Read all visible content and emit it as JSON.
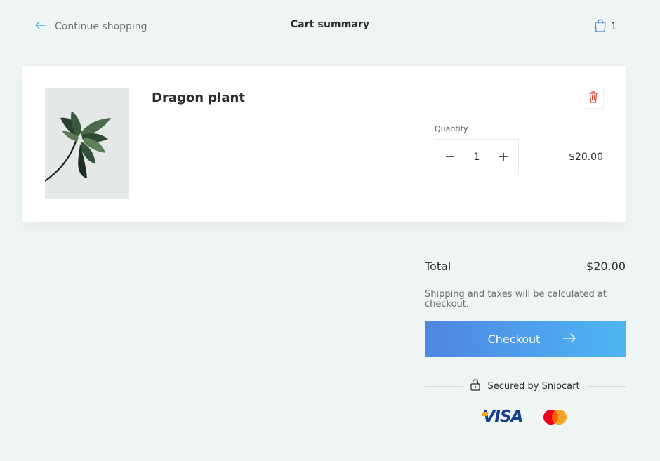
{
  "header": {
    "back_label": "Continue shopping",
    "title": "Cart summary",
    "cart_count": "1"
  },
  "item": {
    "name": "Dragon plant",
    "quantity_label": "Quantity",
    "quantity": "1",
    "price": "$20.00"
  },
  "summary": {
    "total_label": "Total",
    "total_value": "$20.00",
    "shipping_note": "Shipping and taxes will be calculated at checkout.",
    "checkout_label": "Checkout",
    "secured_label": "Secured by Snipcart"
  },
  "payment": {
    "visa": "VISA"
  },
  "colors": {
    "background": "#eff4f4",
    "accent_start": "#4f86e2",
    "accent_end": "#4db6f2",
    "remove": "#d9432f",
    "back_arrow": "#3aa8e0"
  }
}
